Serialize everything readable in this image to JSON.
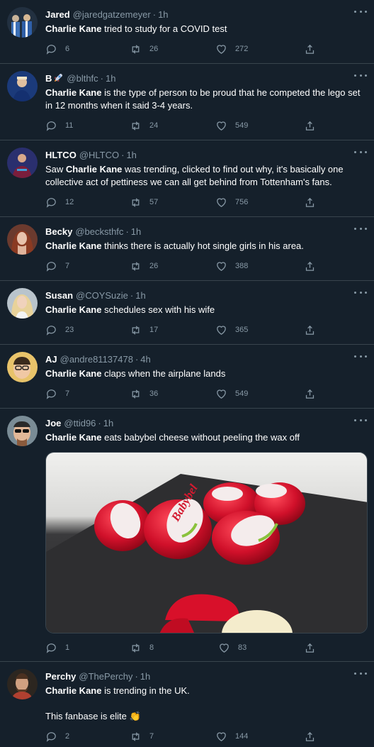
{
  "tweets": [
    {
      "name": "Jared",
      "handle": "@jaredgatzemeyer",
      "time": "1h",
      "bold": "Charlie Kane",
      "text": " tried to study for a COVID test",
      "replies": "6",
      "retweets": "26",
      "likes": "272"
    },
    {
      "name": "B",
      "handle": "@blthfc",
      "time": "1h",
      "bold": "Charlie Kane",
      "text": " is the type of person to be proud that he competed the lego set in 12 months when it said 3-4 years.",
      "replies": "11",
      "retweets": "24",
      "likes": "549"
    },
    {
      "name": "HLTCO",
      "handle": "@HLTCO",
      "time": "1h",
      "pre": "Saw ",
      "bold": "Charlie Kane",
      "text": " was trending, clicked to find out why, it's basically one collective act of pettiness we can all get behind from Tottenham's fans.",
      "replies": "12",
      "retweets": "57",
      "likes": "756"
    },
    {
      "name": "Becky",
      "handle": "@becksthfc",
      "time": "1h",
      "bold": "Charlie Kane",
      "text": " thinks there is actually hot single girls in his area.",
      "replies": "7",
      "retweets": "26",
      "likes": "388"
    },
    {
      "name": "Susan",
      "handle": "@COYSuzie",
      "time": "1h",
      "bold": "Charlie Kane",
      "text": " schedules sex with his wife",
      "replies": "23",
      "retweets": "17",
      "likes": "365"
    },
    {
      "name": "AJ",
      "handle": "@andre81137478",
      "time": "4h",
      "bold": "Charlie Kane",
      "text": " claps when the airplane lands",
      "replies": "7",
      "retweets": "36",
      "likes": "549"
    },
    {
      "name": "Joe",
      "handle": "@ttid96",
      "time": "1h",
      "bold": "Charlie Kane",
      "text": " eats babybel cheese without peeling the wax off",
      "replies": "1",
      "retweets": "8",
      "likes": "83",
      "media_label": "Babybel"
    },
    {
      "name": "Perchy",
      "handle": "@ThePerchy",
      "time": "1h",
      "bold": "Charlie Kane",
      "text": " is trending in the UK.",
      "line2": "This fanbase is elite 👏",
      "replies": "2",
      "retweets": "7",
      "likes": "144"
    }
  ],
  "colors": {
    "background": "#15202b",
    "border": "#38444d",
    "muted": "#8899a6",
    "text": "#ffffff"
  },
  "icons": [
    "reply-icon",
    "retweet-icon",
    "like-icon",
    "share-icon",
    "more-icon",
    "rocket-emoji"
  ]
}
